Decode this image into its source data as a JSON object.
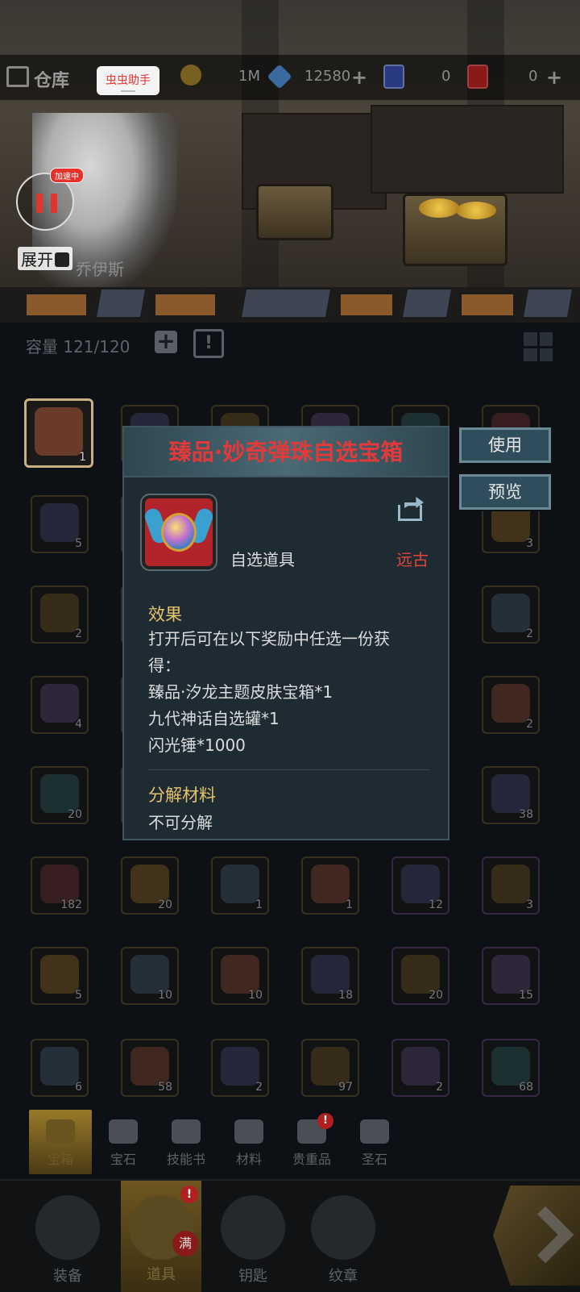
{
  "topbar": {
    "title": "仓库",
    "gold_value": "1M",
    "gem_value": "12580",
    "ticket1_value": "0",
    "ticket2_value": "0"
  },
  "overlay": {
    "helper_label": "虫虫助手",
    "speed_badge": "加速中",
    "expand_label": "展开",
    "npc_name": "乔伊斯"
  },
  "capacity": {
    "label": "容量",
    "value": "121/120"
  },
  "inventory": {
    "rows": [
      [
        "1",
        "",
        "",
        "",
        "",
        ""
      ],
      [
        "5",
        "",
        "",
        "",
        "",
        "3"
      ],
      [
        "2",
        "",
        "",
        "",
        "",
        "2"
      ],
      [
        "4",
        "",
        "",
        "",
        "",
        "2"
      ],
      [
        "20",
        "",
        "",
        "",
        "",
        "38"
      ],
      [
        "182",
        "20",
        "1",
        "1",
        "12",
        "3"
      ],
      [
        "5",
        "10",
        "10",
        "18",
        "20",
        "15"
      ],
      [
        "6",
        "58",
        "2",
        "97",
        "2",
        "68"
      ]
    ]
  },
  "popup": {
    "title": "臻品·妙奇弹珠自选宝箱",
    "item_type": "自选道具",
    "rarity": "远古",
    "effect_heading": "效果",
    "effect_lines": [
      "打开后可在以下奖励中任选一份获",
      "得：",
      "臻品·汐龙主题皮肤宝箱*1",
      "九代神话自选罐*1",
      "闪光锤*1000"
    ],
    "decompose_heading": "分解材料",
    "decompose_value": "不可分解",
    "use_button": "使用",
    "preview_button": "预览"
  },
  "subtabs": [
    {
      "label": "宝箱"
    },
    {
      "label": "宝石"
    },
    {
      "label": "技能书"
    },
    {
      "label": "材料"
    },
    {
      "label": "贵重品",
      "badge": "!"
    },
    {
      "label": "圣石"
    }
  ],
  "mainnav": [
    {
      "label": "装备"
    },
    {
      "label": "道具",
      "badge": "!",
      "full": "满"
    },
    {
      "label": "钥匙"
    },
    {
      "label": "纹章"
    }
  ]
}
